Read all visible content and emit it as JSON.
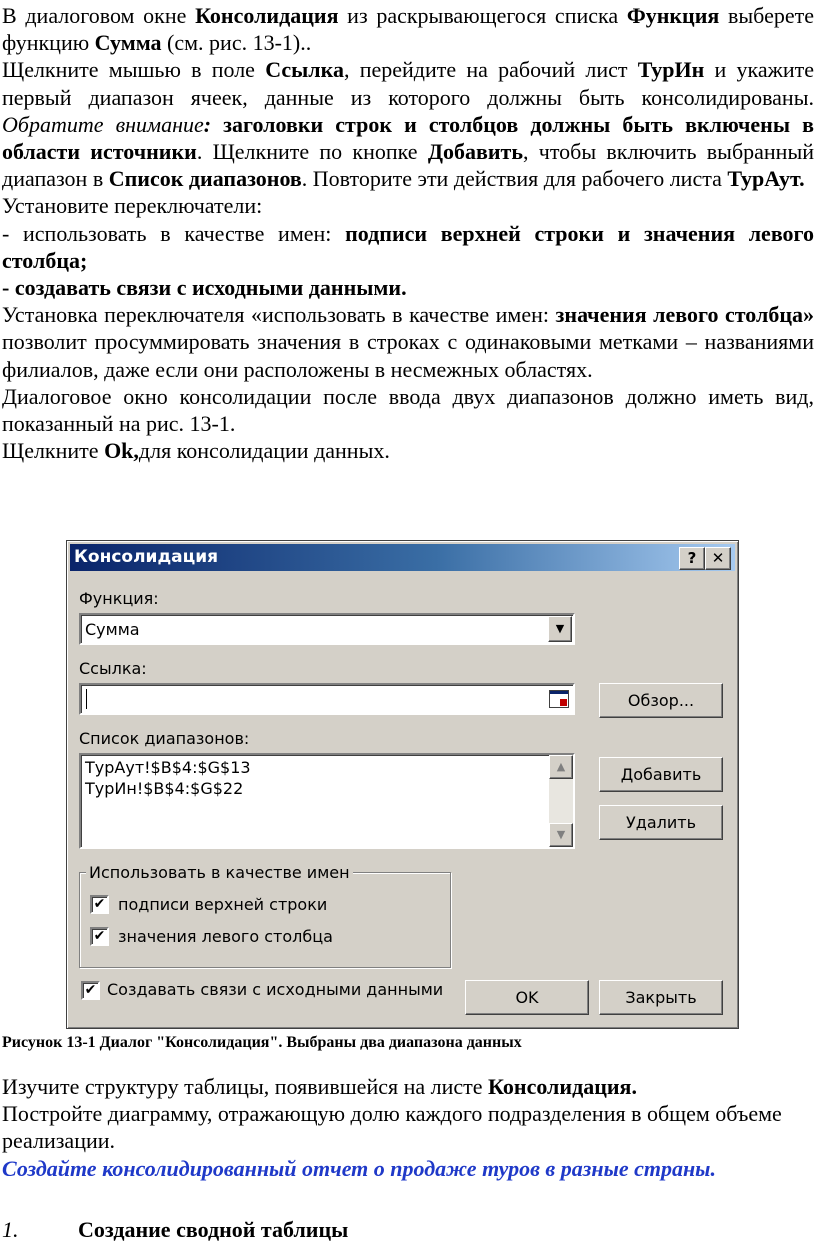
{
  "intro": {
    "p1": [
      "В диалоговом окне ",
      "Консолидация",
      "  из раскрывающегося списка ",
      "Функция",
      " выберете функцию ",
      "Сумма",
      " (см. рис. 13-1).."
    ],
    "p2": [
      "Щелкните мышью в поле ",
      "Ссылка",
      ", перейдите на рабочий лист ",
      "ТурИн",
      " и укажите первый диапазон ячеек, данные из которого должны быть консолидированы. ",
      "Обратите внимание",
      ":",
      " заголовки строк и столбцов должны быть включены в области источники",
      ". Щелкните по кнопке ",
      "Добавить",
      ", чтобы включить выбранный диапазон в ",
      "Список диапазонов",
      ". Повторите эти действия для рабочего листа ",
      "ТурАут."
    ],
    "p3": "Установите переключатели:",
    "p4": [
      "- использовать в качестве имен: ",
      "подписи верхней строки и значения левого столбца;"
    ],
    "p5": "- создавать связи с исходными данными.",
    "p6": [
      "Установка переключателя «использовать в качестве имен: ",
      "значения левого столбца»",
      " позволит просуммировать значения в строках с одинаковыми метками – названиями филиалов, даже если они расположены в несмежных областях."
    ],
    "p7": "Диалоговое окно консолидации после ввода двух диапазонов должно иметь вид, показанный на рис. 13-1.",
    "p8": [
      "Щелкните ",
      "Ok,",
      "для консолидации данных."
    ]
  },
  "dialog": {
    "title": "Консолидация",
    "help_btn": "?",
    "close_btn": "✕",
    "function_label": "Функция:",
    "function_value": "Сумма",
    "ref_label": "Ссылка:",
    "ref_value": "",
    "browse_btn": "Обзор...",
    "list_label": "Список диапазонов:",
    "ranges": [
      "ТурАут!$B$4:$G$13",
      "ТурИн!$B$4:$G$22"
    ],
    "add_btn": "Добавить",
    "delete_btn": "Удалить",
    "group_label": "Использовать в качестве имен",
    "cb_top_row": "подписи верхней строки",
    "cb_left_col": "значения левого столбца",
    "cb_links": "Создавать связи с исходными данными",
    "ok_btn": "OK",
    "close_dialog_btn": "Закрыть"
  },
  "caption": "Рисунок 13-1 Диалог \"Консолидация\". Выбраны два диапазона данных",
  "after": {
    "a1": [
      "Изучите  структуру таблицы, появившейся на листе ",
      "Консолидация."
    ],
    "a2": "Постройте диаграмму, отражающую долю каждого подразделения в общем объеме реализации.",
    "a3": "Создайте консолидированный отчет о продаже туров в разные страны.",
    "section_num": "1.",
    "section_title": "Создание сводной таблицы"
  }
}
